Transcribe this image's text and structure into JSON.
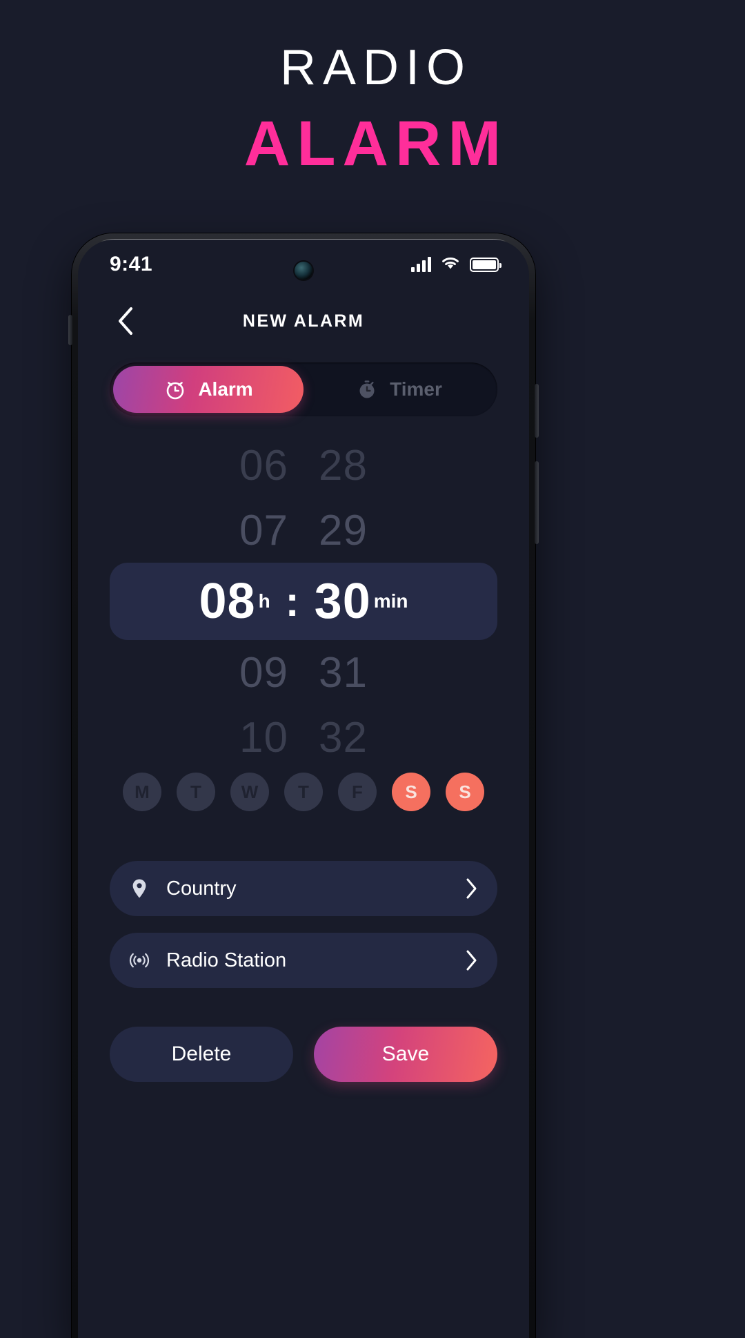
{
  "promo": {
    "line1": "RADIO",
    "line2": "ALARM",
    "line1_color": "#FFFFFF",
    "line2_color": "#FF2E9A"
  },
  "phone": {
    "status_bar": {
      "time": "9:41",
      "signal_icon": "cellular-signal-icon",
      "wifi_icon": "wifi-icon",
      "battery_icon": "battery-full-icon",
      "camera": "front-camera"
    },
    "appbar": {
      "back_icon": "chevron-left-icon",
      "title": "NEW ALARM"
    },
    "tabs": [
      {
        "label": "Alarm",
        "icon": "alarm-clock-icon",
        "active": true
      },
      {
        "label": "Timer",
        "icon": "stopwatch-icon",
        "active": false
      }
    ],
    "time_picker": {
      "rows_above": [
        {
          "hour": "06",
          "minute": "28"
        },
        {
          "hour": "07",
          "minute": "29"
        }
      ],
      "selected": {
        "hour": "08",
        "hour_unit": "h",
        "separator": ":",
        "minute": "30",
        "minute_unit": "min"
      },
      "rows_below": [
        {
          "hour": "09",
          "minute": "31"
        },
        {
          "hour": "10",
          "minute": "32"
        }
      ]
    },
    "weekdays": [
      {
        "label": "M",
        "selected": false
      },
      {
        "label": "T",
        "selected": false
      },
      {
        "label": "W",
        "selected": false
      },
      {
        "label": "T",
        "selected": false
      },
      {
        "label": "F",
        "selected": false
      },
      {
        "label": "S",
        "selected": true
      },
      {
        "label": "S",
        "selected": true
      }
    ],
    "options": [
      {
        "label": "Country",
        "icon": "location-pin-icon",
        "chevron": "chevron-right-icon"
      },
      {
        "label": "Radio Station",
        "icon": "radio-broadcast-icon",
        "chevron": "chevron-right-icon"
      }
    ],
    "footer": {
      "delete_label": "Delete",
      "save_label": "Save"
    },
    "colors": {
      "background": "#191C2B",
      "screen_background": "#181B29",
      "accent_pink": "#FF2E9A",
      "accent_coral": "#F5705F",
      "card_navy": "#242943",
      "selected_pill": "#262B47",
      "muted_text": "#4A4E61"
    }
  }
}
